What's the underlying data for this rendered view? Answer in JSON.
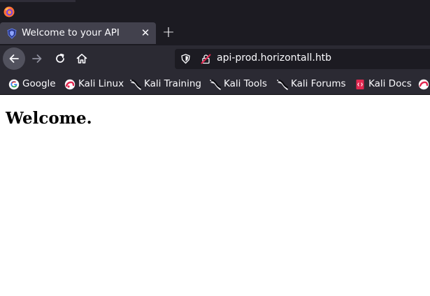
{
  "browser": {
    "tab": {
      "title": "Welcome to your API",
      "close_glyph": "✕",
      "favicon": "strapi-shield-icon"
    },
    "new_tab_glyph": "+",
    "nav": {
      "back": "back-arrow-icon",
      "forward": "forward-arrow-icon",
      "reload": "reload-icon",
      "home": "home-icon"
    },
    "url": "api-prod.horizontall.htb",
    "bookmarks": [
      {
        "label": "Google",
        "icon": "google-icon"
      },
      {
        "label": "Kali Linux",
        "icon": "kali-icon"
      },
      {
        "label": "Kali Training",
        "icon": "kali-dragon-icon"
      },
      {
        "label": "Kali Tools",
        "icon": "kali-dragon-icon"
      },
      {
        "label": "Kali Forums",
        "icon": "kali-dragon-icon"
      },
      {
        "label": "Kali Docs",
        "icon": "kali-docs-icon"
      }
    ]
  },
  "page": {
    "heading": "Welcome."
  },
  "colors": {
    "chrome_dark": "#1c1b22",
    "toolbar": "#2b2a33",
    "active_tab": "#42414d",
    "text_light": "#fbfbfe"
  }
}
